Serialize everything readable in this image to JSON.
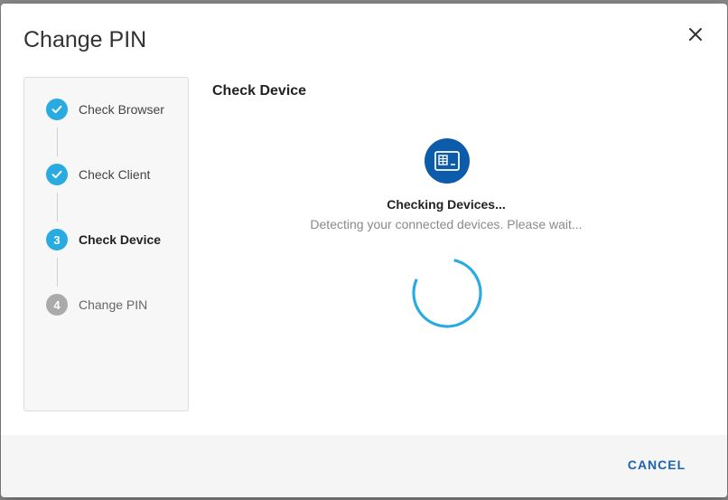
{
  "dialog": {
    "title": "Change PIN",
    "close_icon": "close-icon"
  },
  "stepper": {
    "steps": [
      {
        "label": "Check Browser",
        "state": "complete",
        "marker": "check-icon"
      },
      {
        "label": "Check Client",
        "state": "complete",
        "marker": "check-icon"
      },
      {
        "label": "Check Device",
        "state": "active",
        "number": "3"
      },
      {
        "label": "Change PIN",
        "state": "pending",
        "number": "4"
      }
    ]
  },
  "content": {
    "title": "Check Device",
    "icon": "card-reader-icon",
    "status_title": "Checking Devices...",
    "status_subtitle": "Detecting your connected devices. Please wait..."
  },
  "footer": {
    "cancel_label": "CANCEL"
  },
  "colors": {
    "accent": "#29abe2",
    "primary_dark": "#0d5cab",
    "pending": "#aaaaaa",
    "cancel_text": "#1a64b0"
  }
}
